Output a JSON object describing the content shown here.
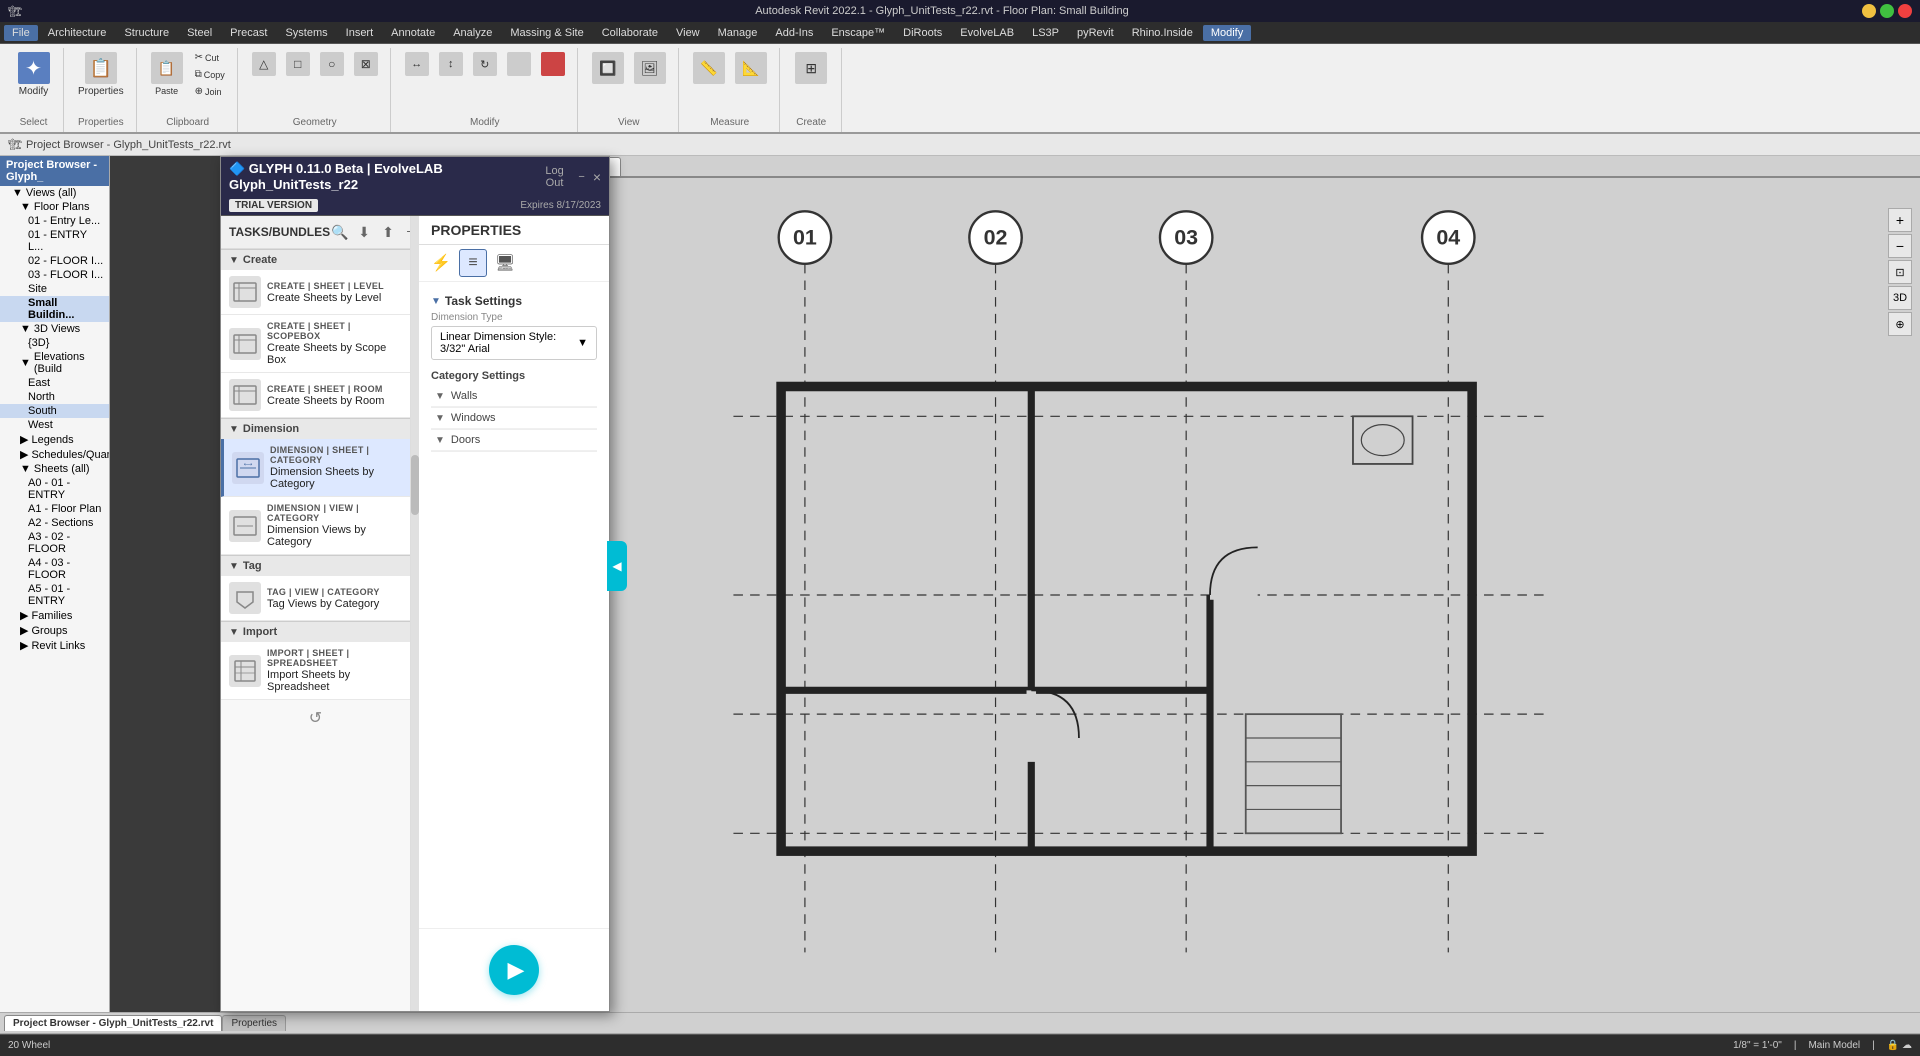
{
  "window": {
    "title": "Autodesk Revit 2022.1 - Glyph_UnitTests_r22.rvt - Floor Plan: Small Building",
    "controls": [
      "minimize",
      "maximize",
      "close"
    ]
  },
  "menu": {
    "items": [
      "File",
      "Architecture",
      "Structure",
      "Steel",
      "Precast",
      "Systems",
      "Insert",
      "Annotate",
      "Analyze",
      "Massing & Site",
      "Collaborate",
      "View",
      "Manage",
      "Add-Ins",
      "Enscape™",
      "DiRoots",
      "EvolveLAB",
      "LS3P",
      "pyRevit",
      "Rhino.Inside",
      "Modify"
    ]
  },
  "ribbon": {
    "active_tab": "Modify",
    "groups": [
      {
        "label": "Select",
        "buttons": [
          "Select"
        ]
      },
      {
        "label": "Properties",
        "buttons": [
          "Properties"
        ]
      },
      {
        "label": "Clipboard",
        "buttons": [
          "Paste",
          "Cut",
          "Copy",
          "Join"
        ]
      },
      {
        "label": "Geometry",
        "buttons": [
          "Geometry"
        ]
      },
      {
        "label": "Modify",
        "buttons": [
          "Modify"
        ]
      },
      {
        "label": "View",
        "buttons": [
          "View"
        ]
      },
      {
        "label": "Measure",
        "buttons": [
          "Measure"
        ]
      },
      {
        "label": "Create",
        "buttons": [
          "Create"
        ]
      }
    ]
  },
  "breadcrumb": {
    "path": "Project Browser - Glyph_UnitTests_r22.rvt"
  },
  "project_browser": {
    "title": "Project Browser - Glyph_",
    "items": [
      {
        "label": "Views (all)",
        "level": 0,
        "type": "section"
      },
      {
        "label": "Floor Plans",
        "level": 1,
        "type": "folder"
      },
      {
        "label": "01 - Entry Le...",
        "level": 2
      },
      {
        "label": "01 - ENTRY L...",
        "level": 2
      },
      {
        "label": "02 - FLOOR I...",
        "level": 2
      },
      {
        "label": "03 - FLOOR I...",
        "level": 2
      },
      {
        "label": "Site",
        "level": 2
      },
      {
        "label": "Small Buildin...",
        "level": 2,
        "selected": true
      },
      {
        "label": "3D Views",
        "level": 1,
        "type": "folder"
      },
      {
        "label": "{3D}",
        "level": 2
      },
      {
        "label": "Elevations (Build",
        "level": 1,
        "type": "folder"
      },
      {
        "label": "East",
        "level": 2
      },
      {
        "label": "North",
        "level": 2
      },
      {
        "label": "South",
        "level": 2,
        "selected": true
      },
      {
        "label": "West",
        "level": 2
      },
      {
        "label": "Legends",
        "level": 1,
        "type": "folder"
      },
      {
        "label": "Schedules/Quant...",
        "level": 1,
        "type": "folder"
      },
      {
        "label": "Sheets (all)",
        "level": 1,
        "type": "folder"
      },
      {
        "label": "A0 - 01 - ENTRY",
        "level": 2
      },
      {
        "label": "A1 - Floor Plan",
        "level": 2
      },
      {
        "label": "A2 - Sections",
        "level": 2
      },
      {
        "label": "A3 - 02 - FLOOR",
        "level": 2
      },
      {
        "label": "A4 - 03 - FLOOR",
        "level": 2
      },
      {
        "label": "A5 - 01 - ENTRY",
        "level": 2
      },
      {
        "label": "Families",
        "level": 1,
        "type": "folder"
      },
      {
        "label": "Groups",
        "level": 1,
        "type": "folder"
      },
      {
        "label": "Revit Links",
        "level": 1,
        "type": "folder"
      }
    ]
  },
  "glyph_panel": {
    "title": "TASKS/BUNDLES",
    "trial_label": "TRIAL VERSION",
    "expires_label": "Expires 8/17/2023",
    "logout_btn": "Log Out",
    "close_btn": "×",
    "search_icon": "search-icon",
    "download_icon": "download-icon",
    "upload_icon": "upload-icon",
    "add_icon": "add-icon",
    "sections": [
      {
        "label": "Create",
        "items": [
          {
            "label_short": "CREATE | SHEET | LEVEL",
            "label_full": "Create Sheets by Level",
            "icon": "📋"
          },
          {
            "label_short": "CREATE | SHEET | SCOPEBOX",
            "label_full": "Create Sheets by Scope Box",
            "icon": "📋"
          },
          {
            "label_short": "CREATE | SHEET | ROOM",
            "label_full": "Create Sheets by Room",
            "icon": "📋"
          }
        ]
      },
      {
        "label": "Dimension",
        "items": [
          {
            "label_short": "DIMENSION | SHEET | CATEGORY",
            "label_full": "Dimension Sheets by Category",
            "icon": "📐",
            "selected": true
          },
          {
            "label_short": "DIMENSION | VIEW | CATEGORY",
            "label_full": "Dimension Views by Category",
            "icon": "📐"
          }
        ]
      },
      {
        "label": "Tag",
        "items": [
          {
            "label_short": "TAG | VIEW | CATEGORY",
            "label_full": "Tag Views by Category",
            "icon": "🏷️"
          }
        ]
      },
      {
        "label": "Import",
        "items": [
          {
            "label_short": "IMPORT | SHEET | SPREADSHEET",
            "label_full": "Import Sheets by Spreadsheet",
            "icon": "📥"
          }
        ]
      }
    ]
  },
  "properties_panel": {
    "title": "PROPERTIES",
    "toolbar_btns": [
      {
        "icon": "⚡",
        "label": "run-icon",
        "active": false
      },
      {
        "icon": "≡",
        "label": "settings-icon",
        "active": true
      },
      {
        "icon": "🖥",
        "label": "preview-icon",
        "active": false
      }
    ],
    "task_settings_label": "Task Settings",
    "dimension_type_label": "Dimension Type",
    "dimension_type_value": "Linear Dimension Style: 3/32\" Arial",
    "category_settings_label": "Category Settings",
    "categories": [
      {
        "label": "Walls",
        "expanded": true
      },
      {
        "label": "Windows",
        "expanded": true
      },
      {
        "label": "Doors",
        "expanded": true
      }
    ],
    "play_btn_label": "▶"
  },
  "canvas": {
    "active_tab": "Small Building",
    "tabs": [
      "Small Building"
    ],
    "view_title": "Floor Plan: Small Building",
    "grid_columns": [
      "01",
      "02",
      "03",
      "04"
    ],
    "scale": "1/8\" = 1'-0\""
  },
  "status_bar": {
    "left": "20 Wheel",
    "bottom_tabs": [
      "Project Browser - Glyph_UnitTests_r22.rvt",
      "Properties"
    ],
    "scale": "1/8\" = 1'-0\"",
    "model": "Main Model"
  }
}
